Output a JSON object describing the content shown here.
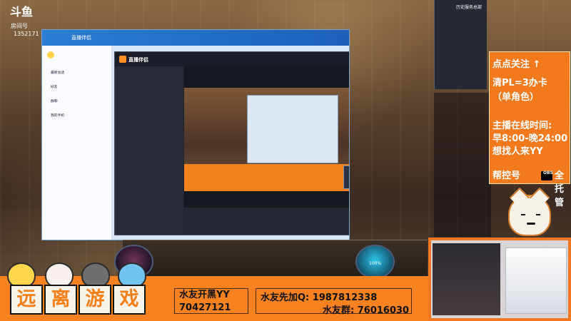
{
  "platform": {
    "logo_text": "斗鱼",
    "room_label": "房间号",
    "room_id": "1352171"
  },
  "desktop": {
    "qq_sidebar_labels": [
      "最新会话",
      "好友",
      "群聊",
      "我的手机"
    ],
    "stream_app_title": "直播伴侣"
  },
  "stream_preview": {
    "game_screen": "preview",
    "bottom_bar": "stream overlay"
  },
  "notice": {
    "line1": "点点关注 ↑",
    "line2": "清PL=3办卡",
    "line3": "（单角色）",
    "line4": "主播在线时间:",
    "line5": "早8:00-晚24:00",
    "line6": "想找人来YY",
    "line7_part1": "帮控号",
    "line7_badge": "OBS",
    "line7_part2": "全托管"
  },
  "footer": {
    "title_chars": [
      "远",
      "离",
      "游",
      "戏"
    ],
    "yy_label": "水友开黑YY",
    "yy_value": "70427121",
    "qq_label": "水友先加Q:",
    "qq_value": "1987812338",
    "group_label": "水友群:",
    "group_value": "76016030"
  },
  "minimap": {
    "location": "历史服务总部"
  },
  "dock": {
    "percent": "100%"
  }
}
